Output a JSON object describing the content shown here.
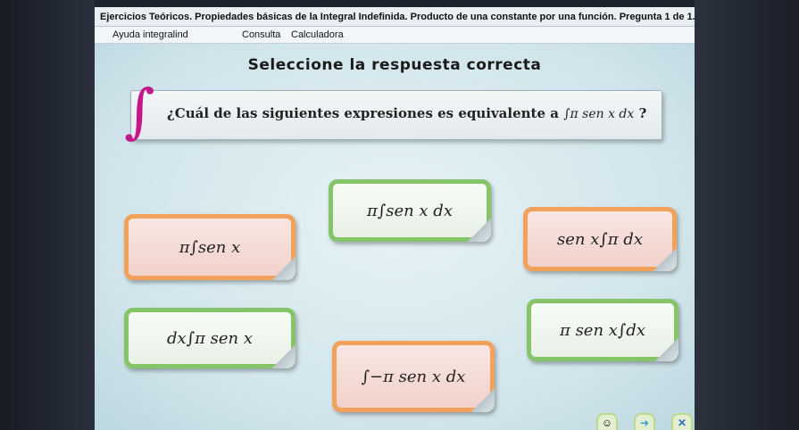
{
  "window": {
    "title": "Ejercicios Teóricos. Propiedades básicas de la Integral Indefinida. Producto de una constante por una función. Pregunta 1 de 1."
  },
  "menu": {
    "items": [
      "Ayuda integralind",
      "Consulta",
      "Calculadora"
    ]
  },
  "instruction": "Seleccione la respuesta correcta",
  "question": {
    "text": "¿Cuál de las siguientes expresiones es equivalente a",
    "expression": "∫π sen x dx",
    "suffix": "?"
  },
  "options": [
    {
      "label": "π∫sen x dx"
    },
    {
      "label": "π∫sen x"
    },
    {
      "label": "sen x∫π dx"
    },
    {
      "label": "dx∫π sen x"
    },
    {
      "label": "π sen x∫dx"
    },
    {
      "label": "∫−π sen x dx"
    }
  ],
  "colors": {
    "green_border": "#86c46a",
    "orange_border": "#f2a15c",
    "question_deco": "#c6178a"
  },
  "bottom_icons": [
    "face-icon",
    "arrow-right-icon",
    "close-icon"
  ]
}
